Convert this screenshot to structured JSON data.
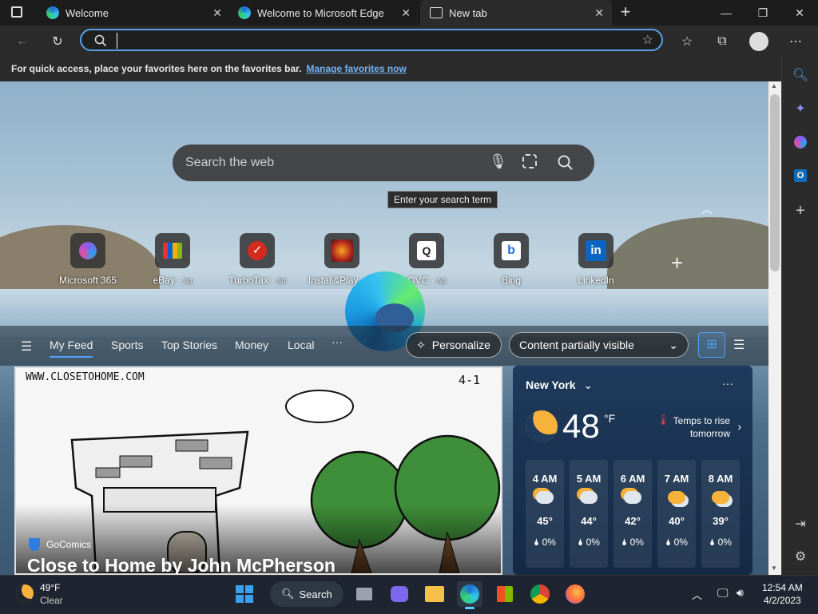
{
  "tabs": [
    {
      "title": "Welcome",
      "active": false
    },
    {
      "title": "Welcome to Microsoft Edge",
      "active": false
    },
    {
      "title": "New tab",
      "active": true
    }
  ],
  "address": {
    "value": "",
    "placeholder": ""
  },
  "favorites_bar": {
    "message": "For quick access, place your favorites here on the favorites bar.",
    "link": "Manage favorites now"
  },
  "search": {
    "placeholder": "Search the web",
    "tooltip": "Enter your search term"
  },
  "quick_links": [
    {
      "label": "Microsoft 365",
      "ad": ""
    },
    {
      "label": "eBay",
      "ad": "Ad"
    },
    {
      "label": "TurboTax",
      "ad": "Ad"
    },
    {
      "label": "Install&Play",
      "ad": "Ad"
    },
    {
      "label": "QVC",
      "ad": "Ad"
    },
    {
      "label": "Bing",
      "ad": ""
    },
    {
      "label": "LinkedIn",
      "ad": ""
    }
  ],
  "feed_nav": {
    "items": [
      "My Feed",
      "Sports",
      "Top Stories",
      "Money",
      "Local"
    ],
    "more": "···",
    "personalize": "Personalize",
    "visibility": "Content partially visible"
  },
  "card": {
    "comic_site": "WWW.CLOSETOHOME.COM",
    "comic_date": "4-1",
    "source": "GoComics",
    "headline": "Close to Home by John McPherson"
  },
  "weather": {
    "city": "New York",
    "temp": "48",
    "unit": "°F",
    "note_line1": "Temps to rise",
    "note_line2": "tomorrow",
    "hours": [
      {
        "time": "4 AM",
        "temp": "45°",
        "precip": "0%"
      },
      {
        "time": "5 AM",
        "temp": "44°",
        "precip": "0%"
      },
      {
        "time": "6 AM",
        "temp": "42°",
        "precip": "0%"
      },
      {
        "time": "7 AM",
        "temp": "40°",
        "precip": "0%"
      },
      {
        "time": "8 AM",
        "temp": "39°",
        "precip": "0%"
      }
    ]
  },
  "taskbar": {
    "weather_temp": "49°F",
    "weather_desc": "Clear",
    "search_label": "Search",
    "time": "12:54 AM",
    "date": "4/2/2023"
  },
  "colors": {
    "accent": "#5aa0e6",
    "link": "#74b3f5",
    "taskbar": "#1e2530"
  }
}
